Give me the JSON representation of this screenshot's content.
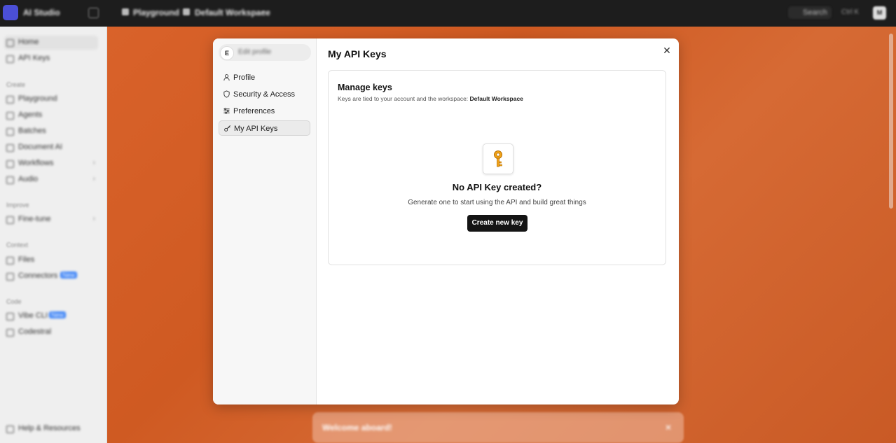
{
  "topbar": {
    "app_title": "AI Studio",
    "crumb_playground": "Playground",
    "crumb_workspace": "Default Workspace",
    "search_label": "Search",
    "shortcut_hint": "Ctrl K",
    "avatar_initials": "M"
  },
  "sidebar": {
    "items_top": [
      "Home",
      "API Keys"
    ],
    "group_create": "Create",
    "items_create": [
      "Playground",
      "Agents",
      "Batches",
      "Document AI",
      "Workflows",
      "Audio"
    ],
    "group_improve": "Improve",
    "items_improve": [
      "Fine-tune"
    ],
    "group_context": "Context",
    "items_context": [
      "Files",
      "Connectors"
    ],
    "connectors_badge": "New",
    "group_code": "Code",
    "items_code": [
      "Vibe CLI",
      "Codestral"
    ],
    "vibe_badge": "New",
    "help": "Help & Resources"
  },
  "welcome": {
    "text": "Welcome aboard!"
  },
  "modal": {
    "user_initial": "E",
    "user_name": "Edit profile",
    "nav": [
      "Profile",
      "Security & Access",
      "Preferences",
      "My API Keys"
    ],
    "title": "My API Keys",
    "card_title": "Manage keys",
    "card_sub_prefix": "Keys are tied to your account and the workspace:",
    "card_sub_workspace": "Default Workspace",
    "empty_title": "No API Key created?",
    "empty_sub": "Generate one to start using the API and build great things",
    "create_button": "Create new key",
    "accent_key_color": "#f0a020"
  }
}
